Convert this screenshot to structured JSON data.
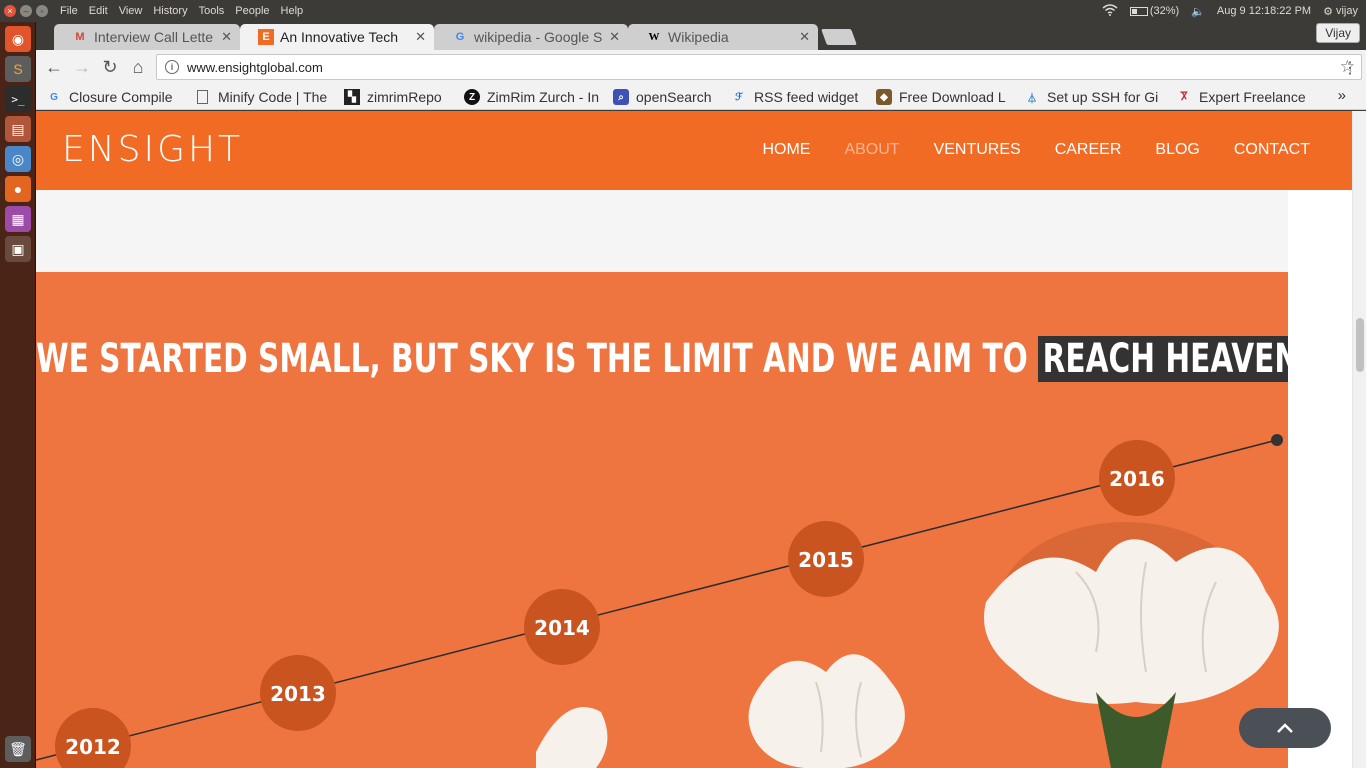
{
  "os": {
    "menu": [
      "File",
      "Edit",
      "View",
      "History",
      "Tools",
      "People",
      "Help"
    ],
    "battery": "(32%)",
    "clock": "Aug  9 12:18:22 PM",
    "user": "vijay"
  },
  "browser": {
    "tabs": [
      {
        "title": "Interview Call Lette",
        "icon": "gmail-icon"
      },
      {
        "title": "An Innovative Tech",
        "icon": "ensight-icon",
        "active": true
      },
      {
        "title": "wikipedia - Google S",
        "icon": "google-icon"
      },
      {
        "title": "Wikipedia",
        "icon": "wikipedia-icon"
      }
    ],
    "profile": "Vijay",
    "url": "www.ensightglobal.com",
    "bookmarks": [
      {
        "label": "Closure Compile"
      },
      {
        "label": "Minify Code | The"
      },
      {
        "label": "zimrimRepo"
      },
      {
        "label": "ZimRim Zurch - In"
      },
      {
        "label": "openSearch"
      },
      {
        "label": "RSS feed widget"
      },
      {
        "label": "Free Download L"
      },
      {
        "label": "Set up SSH for Gi"
      },
      {
        "label": "Expert Freelance"
      }
    ],
    "more": "»"
  },
  "site": {
    "logo": "ENSIGHT",
    "nav": [
      "HOME",
      "ABOUT",
      "VENTURES",
      "CAREER",
      "BLOG",
      "CONTACT"
    ],
    "headline": "WE STARTED SMALL, BUT SKY IS THE LIMIT AND WE AIM TO",
    "headline_highlight": "REACH HEAVEN!",
    "years": [
      "2012",
      "2013",
      "2014",
      "2015",
      "2016"
    ],
    "colors": {
      "brand": "#f26b25",
      "hero": "#ef7540",
      "badge": "#c9541f"
    }
  }
}
